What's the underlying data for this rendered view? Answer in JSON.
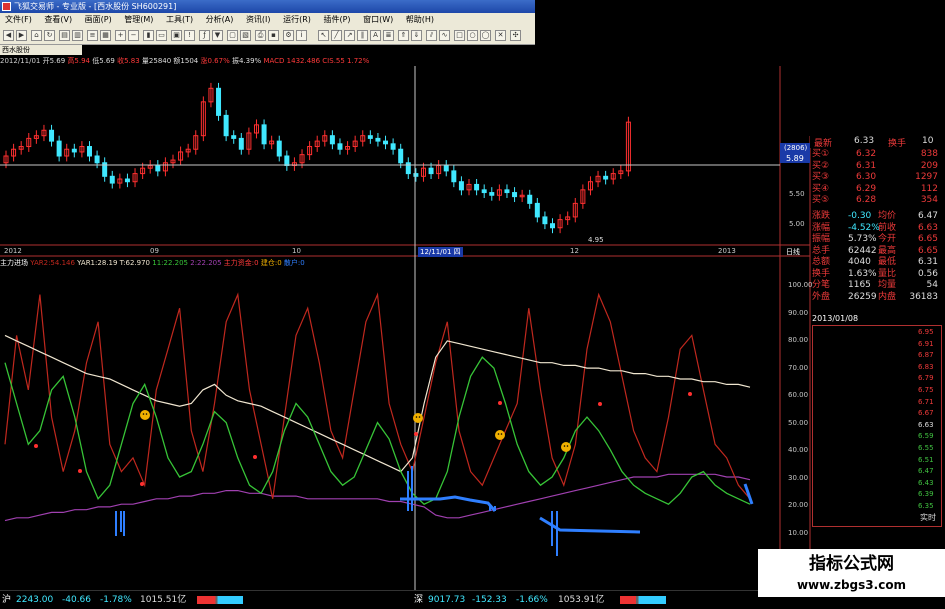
{
  "window": {
    "title": "飞狐交易师 - 专业版 - [西水股份 SH600291]"
  },
  "menu": [
    "文件(F)",
    "查看(V)",
    "画面(P)",
    "管理(M)",
    "工具(T)",
    "分析(A)",
    "资讯(I)",
    "运行(R)",
    "插件(P)",
    "窗口(W)",
    "帮助(H)"
  ],
  "stock_name": "西水股份",
  "price_info": {
    "date": "2012/11/01",
    "open": "开5.69",
    "high": "高5.94",
    "low": "低5.69",
    "close": "收5.83",
    "volume": "量25840",
    "amount": "额1504",
    "change": "涨0.67%",
    "amplitude": "振4.39%",
    "macd": "MACD 1432.486",
    "extra": "CIS.55 1.72%"
  },
  "price_axis": {
    "ticks": [
      "5.50",
      "5.00"
    ],
    "current_tag": "(2806)",
    "current_value": "5.89"
  },
  "date_axis": {
    "labels": [
      "2012",
      "09",
      "10",
      "12/11/01 四",
      "12",
      "2013"
    ],
    "period": "日线"
  },
  "min_label": "4.95",
  "indicator": {
    "name": "主力进场",
    "values": [
      "YAR2:54.146",
      "YAR1:28.19",
      "T:62.970",
      "11:22.205",
      "2:22.205",
      "主力资金:0",
      "建仓:0",
      "散户:0"
    ],
    "yticks": [
      "100.00",
      "90.00",
      "80.00",
      "70.00",
      "60.00",
      "50.00",
      "40.00",
      "30.00",
      "20.00",
      "10.00"
    ]
  },
  "quote": {
    "top": {
      "label": "最新",
      "value": "6.33",
      "label2": "换手",
      "value2": "10"
    },
    "bids": [
      {
        "label": "买①",
        "price": "6.32",
        "vol": "838"
      },
      {
        "label": "买②",
        "price": "6.31",
        "vol": "209"
      },
      {
        "label": "买③",
        "price": "6.30",
        "vol": "1297"
      },
      {
        "label": "买④",
        "price": "6.29",
        "vol": "112"
      },
      {
        "label": "买⑤",
        "price": "6.28",
        "vol": "354"
      }
    ],
    "stats": [
      {
        "l1": "涨跌",
        "v1": "-0.30",
        "l2": "均价",
        "v2": "6.47"
      },
      {
        "l1": "涨幅",
        "v1": "-4.52%",
        "l2": "前收",
        "v2": "6.63"
      },
      {
        "l1": "振幅",
        "v1": "5.73%",
        "l2": "今开",
        "v2": "6.65"
      },
      {
        "l1": "总手",
        "v1": "62442",
        "l2": "最高",
        "v2": "6.65"
      },
      {
        "l1": "总额",
        "v1": "4040",
        "l2": "最低",
        "v2": "6.31"
      },
      {
        "l1": "换手",
        "v1": "1.63%",
        "l2": "量比",
        "v2": "0.56"
      },
      {
        "l1": "分笔",
        "v1": "1165",
        "l2": "均量",
        "v2": "54"
      },
      {
        "l1": "外盘",
        "v1": "26259",
        "l2": "内盘",
        "v2": "36183"
      }
    ],
    "mini_date": "2013/01/08",
    "mini_ticks": [
      "6.95",
      "6.91",
      "6.87",
      "6.83",
      "6.79",
      "6.75",
      "6.71",
      "6.67",
      "6.63",
      "6.59",
      "6.55",
      "6.51",
      "6.47",
      "6.43",
      "6.39",
      "6.35"
    ],
    "mini_realtime": "实时"
  },
  "status": {
    "sh": {
      "label": "沪",
      "index": "2243.00",
      "chg": "-40.66",
      "pct": "-1.78%",
      "amt": "1015.51亿"
    },
    "sz": {
      "label": "深",
      "index": "9017.73",
      "chg": "-152.33",
      "pct": "-1.66%",
      "amt": "1053.91亿"
    }
  },
  "watermark": {
    "title": "指标公式网",
    "url": "www.zbgs3.com"
  },
  "colors": {
    "up": "#ff3030",
    "down": "#40e8ff",
    "line_white": "#f0e6d0",
    "line_green": "#37c437",
    "line_red": "#c0281e",
    "line_purple": "#a040b0",
    "line_blue": "#2f7fff",
    "smiley": "#f0b000"
  }
}
